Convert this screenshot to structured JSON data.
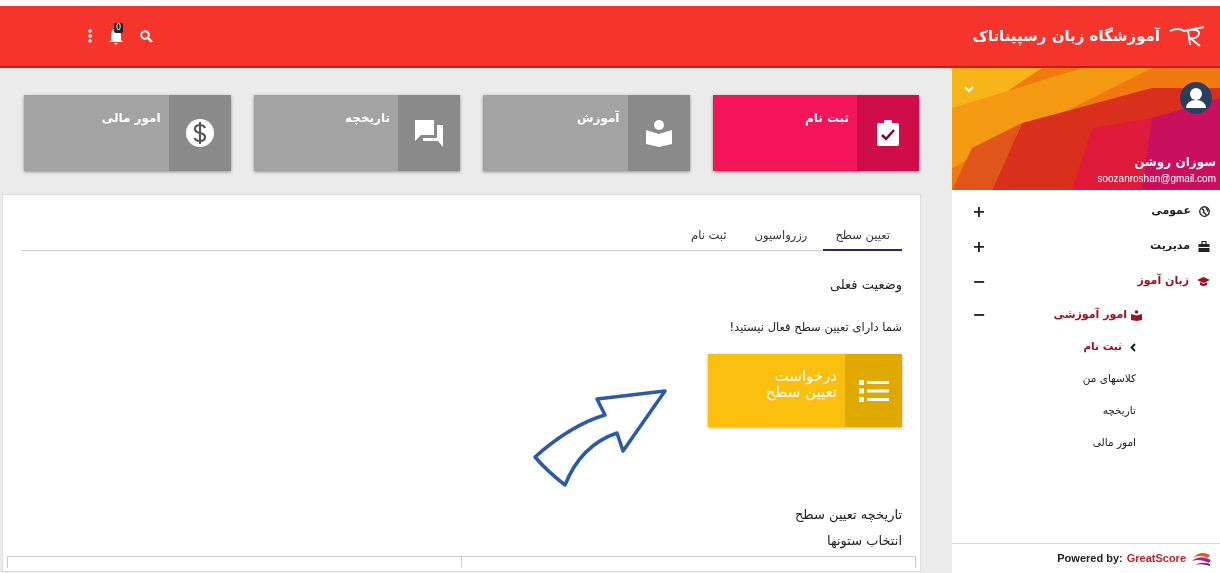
{
  "header": {
    "brand": "آموزشگاه زبان رسپیناتاک",
    "notifications": "0"
  },
  "profile": {
    "name": "سوزان روشن",
    "email": "soozanroshan@gmail.com"
  },
  "menu": [
    {
      "label": "عمومی",
      "toggle": "+",
      "expanded": false
    },
    {
      "label": "مدیریت",
      "toggle": "+",
      "expanded": false
    },
    {
      "label": "زبان آموز",
      "toggle": "−",
      "expanded": true,
      "children": [
        {
          "label": "امور آموزشی",
          "toggle": "−",
          "expanded": true,
          "children": [
            {
              "label": "ثبت نام",
              "selected": true
            },
            {
              "label": "کلاسهای من",
              "selected": false
            },
            {
              "label": "تاریخچه",
              "selected": false
            },
            {
              "label": "امور مالی",
              "selected": false
            }
          ]
        }
      ]
    }
  ],
  "footer": {
    "label": "Powered by:",
    "brand": "GreatScore"
  },
  "tiles": [
    {
      "label": "ثبت نام",
      "selected": true
    },
    {
      "label": "آموزش",
      "selected": false
    },
    {
      "label": "تاریخچه",
      "selected": false
    },
    {
      "label": "امور مالی",
      "selected": false
    }
  ],
  "tabs": [
    {
      "label": "تعیین سطح",
      "selected": true
    },
    {
      "label": "رزرواسیون",
      "selected": false
    },
    {
      "label": "ثبت نام",
      "selected": false
    }
  ],
  "status_title": "وضعیت فعلی",
  "status_message": "شما دارای تعیین سطح فعال نیستید!",
  "request_button": "درخواست\nتعیین سطح",
  "history_title": "تاریخچه تعیین سطح",
  "columns_label": "انتخاب ستونها"
}
